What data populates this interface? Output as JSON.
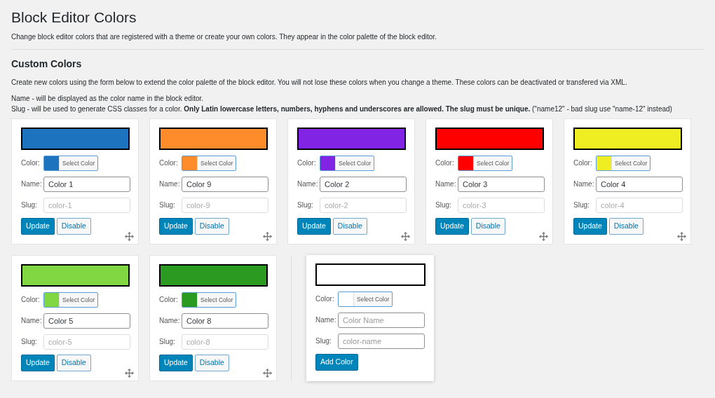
{
  "title": "Block Editor Colors",
  "intro": "Change block editor colors that are registered with a theme or create your own colors. They appear in the color palette of the block editor.",
  "section": {
    "heading": "Custom Colors",
    "description": "Create new colors using the form below to extend the color palette of the block editor. You will not lose these colors when you change a theme. These colors can be deactivated or transfered via XML.",
    "help": [
      "Name - will be displayed as the color name in the block editor.",
      "Slug - will be used to generate CSS classes for a color. **Only Latin lowercase letters, numbers, hyphens and underscores are allowed. The slug must be unique.** (\"name12\" - bad slug use \"name-12\" instead)"
    ]
  },
  "colors": [
    {
      "color": "#1e73be",
      "color_label": "Color:",
      "picker_label": "Select Color",
      "name_label": "Name:",
      "name": "Color 1",
      "slug_label": "Slug:",
      "slug": "color-1",
      "slug_disabled": true,
      "buttons": [
        "Update",
        "Disable"
      ]
    },
    {
      "color": "#ff8c2a",
      "color_label": "Color:",
      "picker_label": "Select Color",
      "name_label": "Name:",
      "name": "Color 9",
      "slug_label": "Slug:",
      "slug": "color-9",
      "slug_disabled": true,
      "buttons": [
        "Update",
        "Disable"
      ]
    },
    {
      "color": "#8224e3",
      "color_label": "Color:",
      "picker_label": "Select Color",
      "name_label": "Name:",
      "name": "Color 2",
      "slug_label": "Slug:",
      "slug": "color-2",
      "slug_disabled": true,
      "buttons": [
        "Update",
        "Disable"
      ]
    },
    {
      "color": "#ff0000",
      "color_label": "Color:",
      "picker_label": "Select Color",
      "name_label": "Name:",
      "name": "Color 3",
      "slug_label": "Slug:",
      "slug": "color-3",
      "slug_disabled": true,
      "buttons": [
        "Update",
        "Disable"
      ]
    },
    {
      "color": "#eeee22",
      "color_label": "Color:",
      "picker_label": "Select Color",
      "name_label": "Name:",
      "name": "Color 4",
      "slug_label": "Slug:",
      "slug": "color-4",
      "slug_disabled": true,
      "buttons": [
        "Update",
        "Disable"
      ]
    },
    {
      "color": "#81d742",
      "color_label": "Color:",
      "picker_label": "Select Color",
      "name_label": "Name:",
      "name": "Color 5",
      "slug_label": "Slug:",
      "slug": "color-5",
      "slug_disabled": true,
      "buttons": [
        "Update",
        "Disable"
      ]
    },
    {
      "color": "#2b9a20",
      "color_label": "Color:",
      "picker_label": "Select Color",
      "name_label": "Name:",
      "name": "Color 8",
      "slug_label": "Slug:",
      "slug": "color-8",
      "slug_disabled": true,
      "buttons": [
        "Update",
        "Disable"
      ]
    }
  ],
  "new_color": {
    "color": "#ffffff",
    "color_label": "Color:",
    "picker_label": "Select Color",
    "name_label": "Name:",
    "name_placeholder": "Color Name",
    "slug_label": "Slug:",
    "slug_placeholder": "color-name",
    "button": "Add Color"
  }
}
